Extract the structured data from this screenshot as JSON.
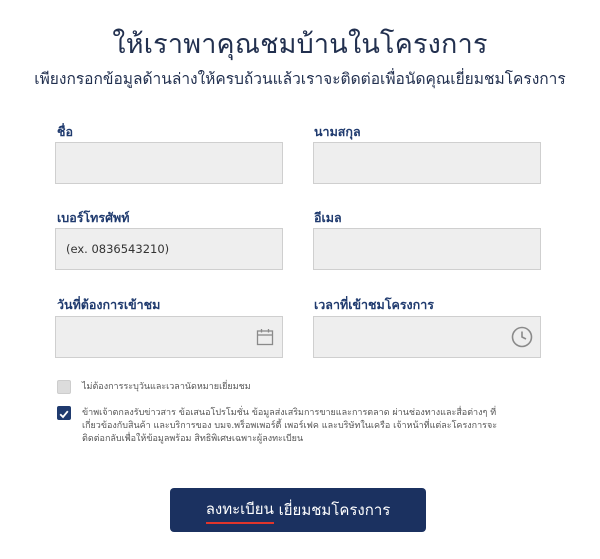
{
  "header": {
    "title": "ให้เราพาคุณชมบ้านในโครงการ",
    "subtitle": "เพียงกรอกข้อมูลด้านล่างให้ครบถ้วนแล้วเราจะติดต่อเพื่อนัดคุณเยี่ยมชมโครงการ"
  },
  "form": {
    "first_name": {
      "label": "ชื่อ",
      "value": "",
      "placeholder": ""
    },
    "last_name": {
      "label": "นามสกุล",
      "value": "",
      "placeholder": ""
    },
    "phone": {
      "label": "เบอร์โทรศัพท์",
      "value": "",
      "placeholder": "(ex. 0836543210)"
    },
    "email": {
      "label": "อีเมล",
      "value": "",
      "placeholder": ""
    },
    "visit_date": {
      "label": "วันที่ต้องการเข้าชม",
      "value": "",
      "placeholder": "",
      "icon": "calendar-icon"
    },
    "visit_time": {
      "label": "เวลาที่เข้าชมโครงการ",
      "value": "",
      "placeholder": "",
      "icon": "clock-icon"
    }
  },
  "options": {
    "no_appointment": {
      "label": "ไม่ต้องการระบุวันและเวลานัดหมายเยี่ยมชม",
      "checked": false
    },
    "consent": {
      "checked": true,
      "lines": [
        "ข้าพเจ้าตกลงรับข่าวสาร ข้อเสนอโปรโมชั่น ข้อมูลส่งเสริมการขายและการตลาด ผ่านช่องทางและสื่อต่างๆ ที่",
        "เกี่ยวข้องกับสินค้า และบริการของ บมจ.พร็อพเพอร์ตี้ เพอร์เฟค และบริษัทในเครือ เจ้าหน้าที่แต่ละโครงการจะ",
        "ติดต่อกลับเพื่อให้ข้อมูลพร้อม สิทธิพิเศษเฉพาะผู้ลงทะเบียน"
      ]
    }
  },
  "submit": {
    "label_underlined": "ลงทะเบียน",
    "label_rest": " เยี่ยมชมโครงการ",
    "accent_color": "#e0352b",
    "bg_color": "#1b3160"
  }
}
